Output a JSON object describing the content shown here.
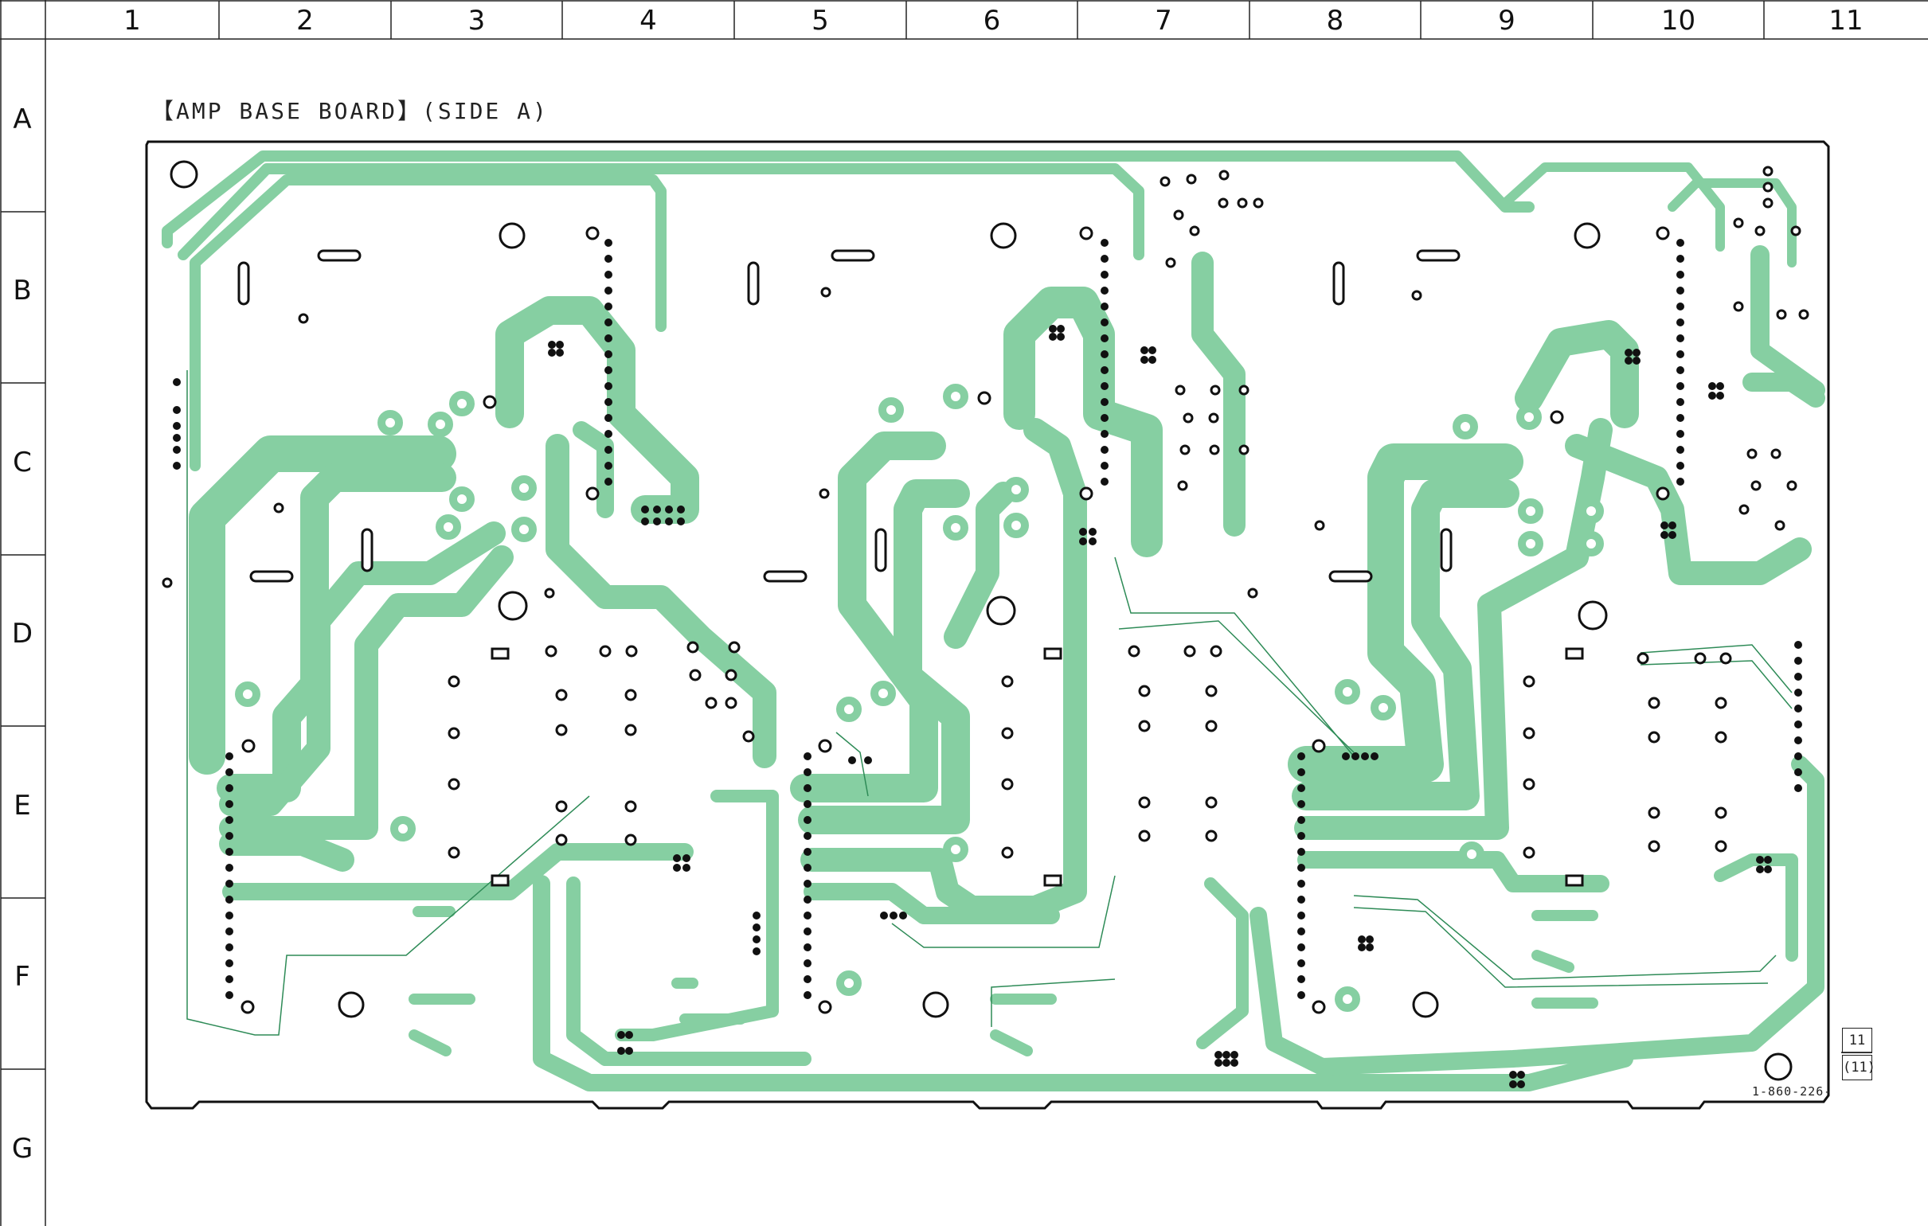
{
  "grid": {
    "columns": [
      "1",
      "2",
      "3",
      "4",
      "5",
      "6",
      "7",
      "8",
      "9",
      "10",
      "11"
    ],
    "rows": [
      "A",
      "B",
      "C",
      "D",
      "E",
      "F",
      "G"
    ]
  },
  "board": {
    "title": "【AMP BASE BOARD】(SIDE A)",
    "part_number": "1-860-226-",
    "page_top": "11",
    "page_bottom": "(11)"
  },
  "colors": {
    "copper": "#86cfa2",
    "outline": "#111111",
    "grid": "#222222",
    "background": "#ffffff"
  }
}
